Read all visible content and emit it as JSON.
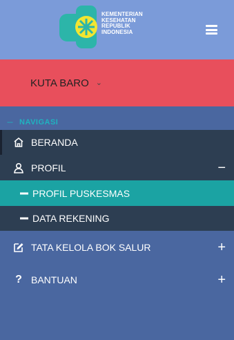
{
  "brand": {
    "logo_lines": [
      "KEMENTERIAN",
      "KESEHATAN",
      "REPUBLIK",
      "INDONESIA"
    ],
    "colors": {
      "header": "#7b9bd9",
      "location": "#e84f5c",
      "sidebar": "#4a67a0",
      "dark_item": "#2d3e52",
      "active_item": "#1ba3a3",
      "accent": "#1fb3c0"
    }
  },
  "location": {
    "label": "KUTA BARO",
    "chevron": "⌄"
  },
  "navigation": {
    "header_dash": "---",
    "header_label": "NAVIGASI",
    "items": [
      {
        "label": "BERANDA",
        "icon": "home-icon"
      },
      {
        "label": "PROFIL",
        "icon": "user-icon",
        "toggle": "−"
      },
      {
        "label": "PROFIL PUSKESMAS",
        "active": true
      },
      {
        "label": "DATA REKENING"
      },
      {
        "label": "TATA KELOLA BOK SALUR",
        "icon": "edit-icon",
        "toggle": "+"
      },
      {
        "label": "BANTUAN",
        "icon": "help-icon",
        "toggle": "+"
      }
    ]
  }
}
